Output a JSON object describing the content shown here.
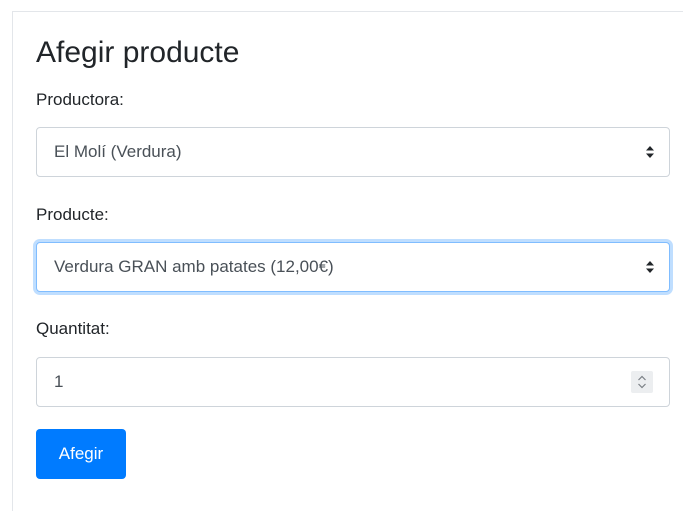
{
  "form": {
    "title": "Afegir producte",
    "producer": {
      "label": "Productora:",
      "selected": "El Molí (Verdura)"
    },
    "product": {
      "label": "Producte:",
      "selected": "Verdura GRAN amb patates (12,00€)"
    },
    "quantity": {
      "label": "Quantitat:",
      "value": "1"
    },
    "submit_label": "Afegir"
  },
  "colors": {
    "primary": "#007bff",
    "focus_border": "#80bdff",
    "input_border": "#ced4da",
    "text": "#212529"
  },
  "icons": {
    "select_arrows": "updown-arrows-icon",
    "spinner": "spinner-arrows-icon"
  }
}
